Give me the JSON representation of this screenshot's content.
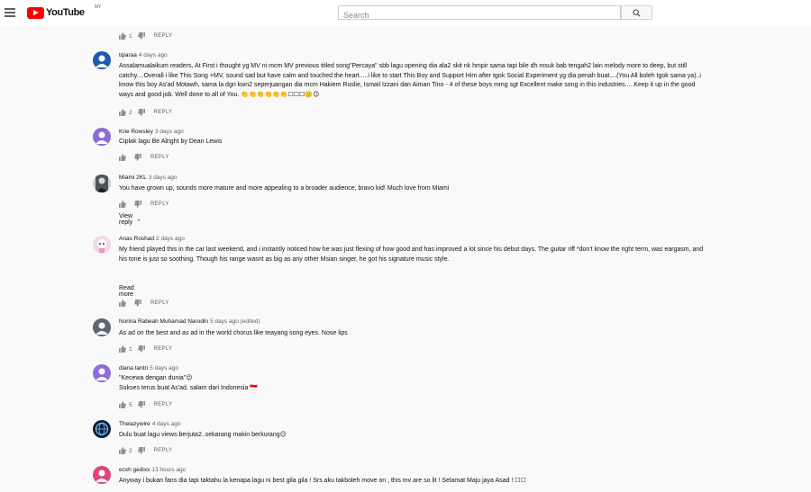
{
  "app": {
    "logo_text": "YouTube",
    "country": "MY",
    "search_placeholder": "Search",
    "colors": {
      "brand": "#ff0000",
      "background": "#f9f9f9"
    }
  },
  "comments": [
    {
      "author": "",
      "time": "",
      "text": "",
      "likes": "1",
      "reply": "REPLY",
      "avatar": "partial-top"
    },
    {
      "author": "tqiaraa",
      "time": "4 days ago",
      "text": "Assalamualaikum readers, At First i thought yg MV ni mcm MV previous titled song\"Percaya\" sbb lagu opening dia ala2 skit nk hmpir sama tapi bile dh msuk bab tengah2 lain melody more to deep, but still catchy....Overall i like This Song +MV,  sound sad but have calm and touched the heart.....i like to start This Boy and Support Him after tgok Social Experiment yg dia penah buat....(You All boleh tgok sama ya)..i know this boy As'ad Motawh, sama la dgn kwn2 seperjuangan dia mcm Hakiem Ruslie, Ismail Izzani dan Aiman Tino - 4 of these boys mmg sgt Excellent make song in this industries.....Keep it up in the good ways and good job. Well done to all of You. 👏👏👏👏👏👏☐☐☐🙂😉",
      "likes": "2",
      "reply": "REPLY",
      "avatar": "blue"
    },
    {
      "author": "Krie Rowsley",
      "time": "3 days ago",
      "text": "Ciplak lagu Be Alright by Dean Lewis",
      "likes": "",
      "reply": "REPLY",
      "avatar": "purple"
    },
    {
      "author": "Miami 2KL",
      "time": "3 days ago",
      "text": "You have grown up, sounds more mature and more appealing to a broader audience, bravo kid! Much love from Miami",
      "likes": "",
      "reply": "REPLY",
      "view_reply": "View reply",
      "avatar": "photo"
    },
    {
      "author": "Anas Roshad",
      "time": "2 days ago",
      "text": "My friend played this in the car last weekend, and i instantly noticed how he was just flexing of how good and has improved a lot since his debut days. The guitar riff *don't know the right term, was eargasm, and his tone is just so soothing. Though his range wasnt as big as any other Msian singer, he got his signature music style.",
      "likes": "",
      "reply": "REPLY",
      "read_more": "Read more",
      "avatar": "cartoon"
    },
    {
      "author": "Norina Rabeah Muhamad Narodin",
      "time": "5 days ago (edited)",
      "text": "As ad on the best and as ad  in the world chorus like teayang song eyes. Nose lips",
      "likes": "1",
      "reply": "REPLY",
      "avatar": "gray"
    },
    {
      "author": "diana tantri",
      "time": "5 days ago",
      "text": "\"Kecewa dengan dunia\"😉\nSukses terus buat As'ad, salam dari Indonesia 🇮🇩",
      "likes": "5",
      "reply": "REPLY",
      "avatar": "purple"
    },
    {
      "author": "Thelazywire",
      "time": "4 days ago",
      "text": "Dulu buat lagu views berjuta2..sekarang makin berkurang😉",
      "likes": "2",
      "reply": "REPLY",
      "avatar": "globe"
    },
    {
      "author": "ecxh gedixx",
      "time": "13 hours ago",
      "text": "Anyway i bukan fans dia tapi taktahu la kenapa lagu ni best gila gila ! Srs aku takboleh move on , this mv are so lit ! Selamat Maju jaya Asad ! ☐☐",
      "likes": "",
      "reply": "REPLY",
      "avatar": "pink"
    }
  ]
}
